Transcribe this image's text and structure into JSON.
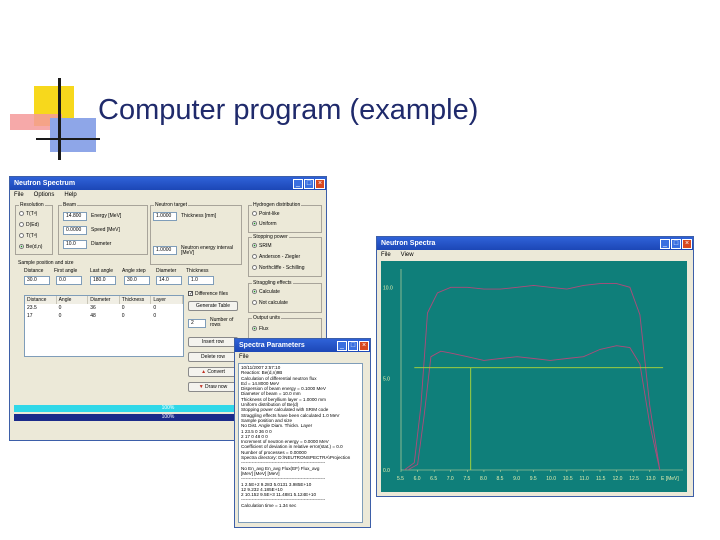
{
  "slide": {
    "title": "Computer program (example)"
  },
  "win_main": {
    "title": "Neutron Spectrum",
    "menu": [
      "File",
      "Options",
      "Help"
    ],
    "resolution": {
      "label": "Resolution",
      "options": [
        "T(Tᵈ)",
        "D(Ed)",
        "T(Tᵈ)",
        "Be(d,n)"
      ],
      "selected_index": 3
    },
    "beam": {
      "label": "Beam",
      "energy_value": "14.800",
      "energy_label": "Energy [MeV]",
      "speed_value": "0.0000",
      "speed_label": "Speed [MeV]",
      "diam_value": "10.0",
      "diam_label": "Diameter"
    },
    "neutron_target": {
      "label": "Neutron target",
      "thickness_value": "1.0000",
      "thickness_label": "Thickness [mm]",
      "energy_value": "1.0000",
      "energy_label": "Neutron energy interval [MeV]"
    },
    "hydrogen": {
      "label": "Hydrogen distribution",
      "options": [
        "Point-like",
        "Uniform"
      ],
      "selected_index": 1
    },
    "stopping_power": {
      "label": "Stopping power",
      "options": [
        "SRIM",
        "Anderson - Ziegler",
        "Northcliffe - Schilling"
      ],
      "selected_index": 0
    },
    "straggling": {
      "label": "Straggling effects",
      "options": [
        "Calculate",
        "Not calculate"
      ],
      "selected_index": 0
    },
    "output": {
      "label": "Output units",
      "options": [
        "Flux"
      ],
      "selected_index": 0
    },
    "sample": {
      "label": "Sample position and size",
      "headers": [
        "Distance",
        "First angle",
        "Last angle",
        "Angle step",
        "Diameter",
        "Thickness"
      ],
      "values": [
        "30.0",
        "0.0",
        "180.0",
        "30.0",
        "14.0",
        "1.0"
      ]
    },
    "layers": {
      "headers": [
        "Distance",
        "Angle",
        "Diameter",
        "Thickness",
        "Layer"
      ],
      "rows": [
        [
          "23.5",
          "0",
          "36",
          "0",
          "0"
        ],
        [
          "17",
          "0",
          "48",
          "0",
          "0"
        ]
      ]
    },
    "diff_check_label": "Difference files",
    "gen_table_label": "Generate Table",
    "num_value": "2",
    "num_label": "Number of rows",
    "buttons": [
      "Insert row",
      "Delete row",
      "Convert",
      "Draw now"
    ],
    "progress": [
      {
        "label": "100%",
        "fraction": 1.0,
        "color": "#30d8e8"
      },
      {
        "label": "100%",
        "fraction": 1.0,
        "color": "#1a2a8a"
      }
    ]
  },
  "win_params": {
    "title": "Spectra Parameters",
    "menu": [
      "File"
    ],
    "lines": [
      "10/11/2007 2:57:10",
      "Reaction: Be(d,n)9B",
      "Calculation of differential neutron flux",
      "Ed = 14.8000 MeV",
      "Dispersion of beam energy = 0.1000 MeV",
      "Diameter of beam = 10.0 mm",
      "Thickness of beryllium layer = 1.0000 mm",
      "Uniform distribution of Be(d)",
      "Stopping power calculated with SRIM code",
      "Straggling effects have been calculated 1.0 MeV",
      "Sample position and size",
      "No      Dist.   Angle   Diam.   Thickn.   Layer",
      "1       23.5    0       36      0         0",
      "2       17      0       48      0         0",
      "Increment of neutron energy = 0.0000 MeV",
      "Coefficient of deviation in relative error(stat.) = 0.0",
      "Number of processes = 0.00000",
      "Spectra directory: D:\\NEUTRONSPECTRA\\Projection",
      "-------------------------------------------------------",
      "No      En_avg    En_avg    Flux(EF)   Flux_avg",
      "        [MeV]     [MeV]     [MeV]",
      "-------------------------------------------------------",
      "1       2.5E+2    9.283     5.0131     3.985E+10",
      "12              9.232              4.185E+10",
      "2       10.152    9.5E+3    11.4881    5.124E+10",
      "-------------------------------------------------------",
      "Calculation time = 1.34 sec"
    ]
  },
  "win_chart": {
    "title": "Neutron Spectra",
    "menu": [
      "File",
      "View"
    ],
    "chart_data": {
      "type": "line",
      "title": "",
      "xlabel": "",
      "ylabel": "",
      "unit_label": "E [MeV]",
      "xlim": [
        5.5,
        14.0
      ],
      "ylim": [
        0,
        11
      ],
      "x_ticks": [
        "5.5",
        "6.0",
        "6.5",
        "7.0",
        "7.5",
        "8.0",
        "8.5",
        "9.0",
        "9.5",
        "10.0",
        "10.5",
        "11.0",
        "11.5",
        "12.0",
        "12.5",
        "13.0"
      ],
      "y_ticks": [
        "10.0",
        "5.0",
        "0.0"
      ],
      "y_tick_values": [
        10,
        5,
        0
      ],
      "grid": false,
      "legend": "none",
      "series": [
        {
          "color": "#b04a7a",
          "x": [
            5.6,
            5.9,
            6.1,
            6.3,
            6.6,
            7.0,
            7.5,
            8.0,
            8.5,
            9.0,
            9.5,
            10.0,
            10.5,
            11.0,
            11.5,
            12.0,
            12.4,
            12.7,
            13.0,
            13.3
          ],
          "y": [
            0.0,
            0.4,
            3.5,
            8.6,
            9.7,
            10.0,
            10.0,
            9.9,
            9.9,
            10.0,
            10.1,
            10.0,
            9.9,
            10.1,
            10.2,
            10.2,
            10.0,
            8.5,
            3.5,
            0.0
          ]
        },
        {
          "color": "#b04a7a",
          "x": [
            5.7,
            6.0,
            6.2,
            6.4,
            6.7,
            7.0,
            7.5,
            8.0,
            8.5,
            9.0,
            9.5,
            10.0,
            10.5,
            11.0,
            11.5,
            12.0,
            12.4,
            12.7,
            13.0,
            13.3
          ],
          "y": [
            0.0,
            0.3,
            3.0,
            6.2,
            6.5,
            6.4,
            6.2,
            6.0,
            6.1,
            6.2,
            6.1,
            6.0,
            6.1,
            6.2,
            6.6,
            6.8,
            6.7,
            5.8,
            2.5,
            0.0
          ]
        },
        {
          "color": "#b0d838",
          "x": [
            5.9,
            13.4
          ],
          "y": [
            5.6,
            5.6
          ]
        },
        {
          "color": "#b0d838",
          "x": [
            7.6,
            7.6
          ],
          "y": [
            0.0,
            5.6
          ]
        }
      ]
    }
  },
  "colors": {
    "window_face": "#ece9d8",
    "title_blue": "#1c47b6",
    "plot_bg": "#0f7f7a",
    "curve": "#b04a7a",
    "marker": "#b0d838"
  }
}
